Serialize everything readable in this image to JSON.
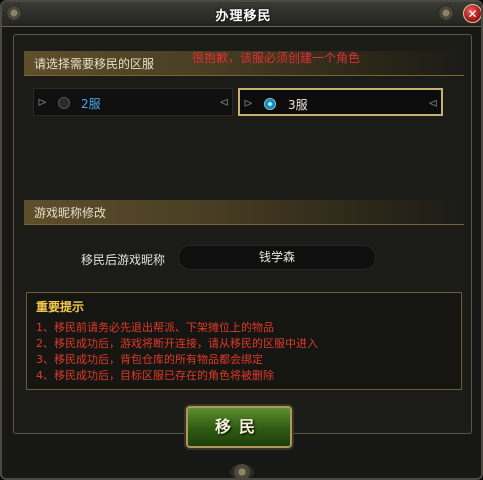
{
  "window": {
    "title": "办理移民",
    "close_label": "✕"
  },
  "server_section": {
    "label": "请选择需要移民的区服",
    "warning": "很抱歉，该服必须创建一个角色",
    "servers": [
      {
        "name": "2服",
        "selected": false
      },
      {
        "name": "3服",
        "selected": true
      }
    ]
  },
  "nickname_section": {
    "label": "游戏昵称修改",
    "field_label": "移民后游戏昵称",
    "field_value": "钱学森"
  },
  "notice": {
    "title": "重要提示",
    "lines": [
      "1、移民前请务必先退出帮派、下架摊位上的物品",
      "2、移民成功后，游戏将断开连接，请从移民的区服中进入",
      "3、移民成功后，背包仓库的所有物品都会绑定",
      "4、移民成功后，目标区服已存在的角色将被删除"
    ]
  },
  "confirm_button": {
    "label": "移民"
  },
  "colors": {
    "warning_red": "#e03030",
    "notice_title_gold": "#f2c94a",
    "button_green": "#3e6e1c",
    "selected_border": "#c9b070"
  }
}
